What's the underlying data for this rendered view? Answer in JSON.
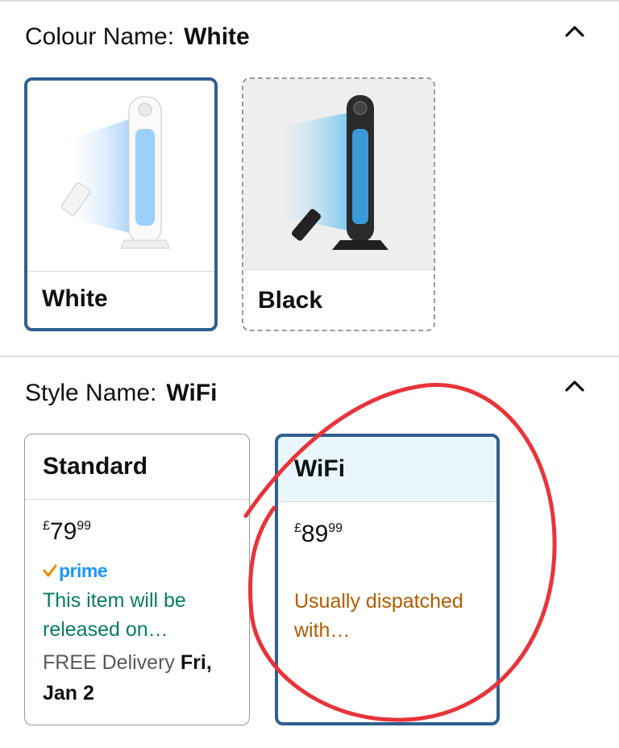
{
  "colour": {
    "label": "Colour Name:",
    "selected": "White",
    "options": [
      {
        "name": "White"
      },
      {
        "name": "Black"
      }
    ]
  },
  "style": {
    "label": "Style Name:",
    "selected": "WiFi",
    "options": [
      {
        "name": "Standard",
        "price_currency": "£",
        "price_whole": "79",
        "price_fraction": "99",
        "badge": "prime",
        "availability": "This item will be released on…",
        "delivery_prefix": "FREE Delivery",
        "delivery_date": "Fri, Jan 2"
      },
      {
        "name": "WiFi",
        "price_currency": "£",
        "price_whole": "89",
        "price_fraction": "99",
        "availability": "Usually dispatched with…"
      }
    ]
  },
  "colors": {
    "selected_border": "#2f5f8f",
    "prime_blue": "#1a98ff",
    "availability_green": "#067d62",
    "dispatch_orange": "#b35b00",
    "annotation_red": "#e8343a"
  },
  "icons": {
    "collapse": "chevron-up-icon",
    "prime_check": "prime-check-icon"
  }
}
